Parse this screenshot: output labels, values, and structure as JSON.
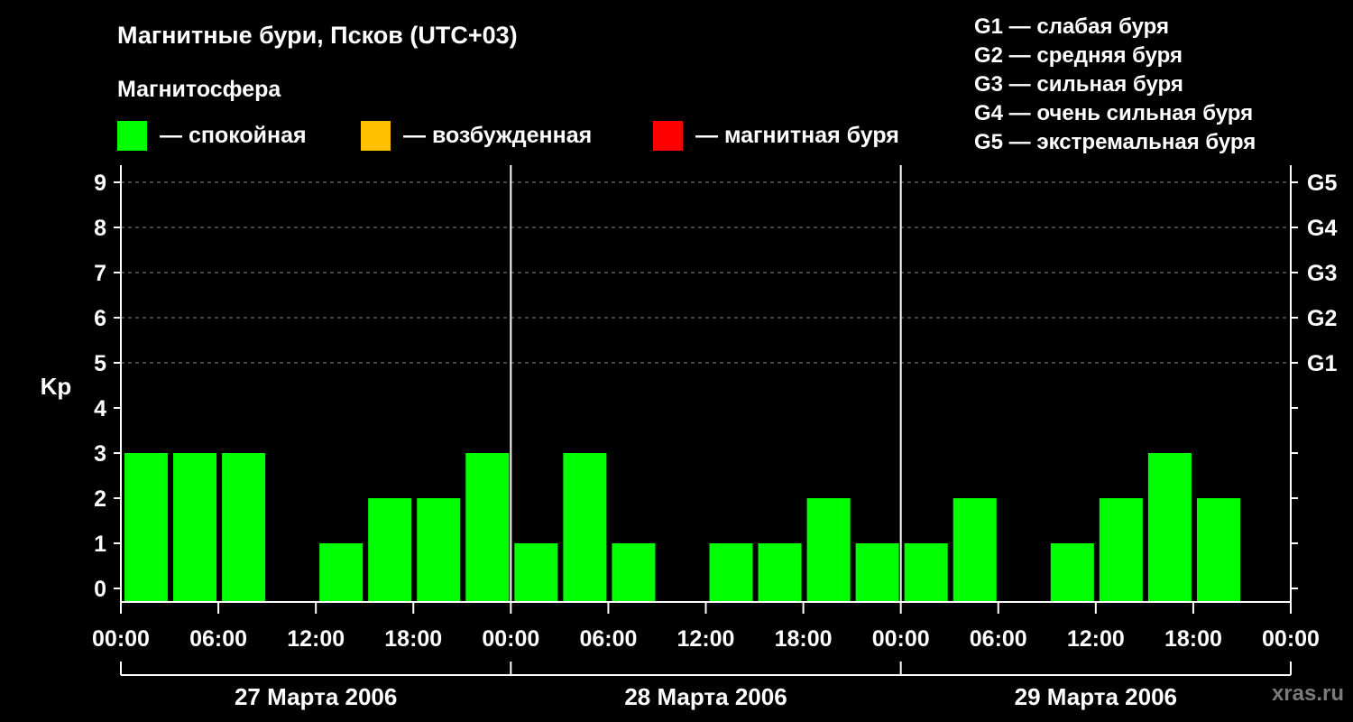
{
  "header": {
    "title": "Магнитные бури, Псков (UTC+03)",
    "subtitle": "Магнитосфера"
  },
  "legend": {
    "items": [
      {
        "label": "— спокойная",
        "color": "#00ff00"
      },
      {
        "label": "— возбужденная",
        "color": "#ffc000"
      },
      {
        "label": "— магнитная буря",
        "color": "#ff0000"
      }
    ]
  },
  "storm_levels": [
    "G1 — слабая буря",
    "G2 — средняя буря",
    "G3 — сильная буря",
    "G4 — очень сильная буря",
    "G5 — экстремальная буря"
  ],
  "watermark": "xras.ru",
  "colors": {
    "background": "#000000",
    "quiet": "#00ff00",
    "axis": "#ffffff",
    "grid": "#888888"
  },
  "chart_data": {
    "type": "bar",
    "ylabel": "Kp",
    "ylim": [
      0,
      9
    ],
    "yticks": [
      0,
      1,
      2,
      3,
      4,
      5,
      6,
      7,
      8,
      9
    ],
    "right_ticks": [
      {
        "value": 5,
        "label": "G1"
      },
      {
        "value": 6,
        "label": "G2"
      },
      {
        "value": 7,
        "label": "G3"
      },
      {
        "value": 8,
        "label": "G4"
      },
      {
        "value": 9,
        "label": "G5"
      }
    ],
    "grid": "dashed at Kp 5–9",
    "xtick_labels": [
      "00:00",
      "06:00",
      "12:00",
      "18:00",
      "00:00",
      "06:00",
      "12:00",
      "18:00",
      "00:00",
      "06:00",
      "12:00",
      "18:00",
      "00:00"
    ],
    "days": [
      "27 Марта 2006",
      "28 Марта 2006",
      "29 Марта 2006"
    ],
    "interval_hours": 3,
    "values": [
      3,
      3,
      3,
      0,
      1,
      2,
      2,
      3,
      1,
      3,
      1,
      0,
      1,
      1,
      2,
      1,
      1,
      2,
      0,
      1,
      2,
      3,
      2
    ],
    "series_color": "#00ff00"
  }
}
